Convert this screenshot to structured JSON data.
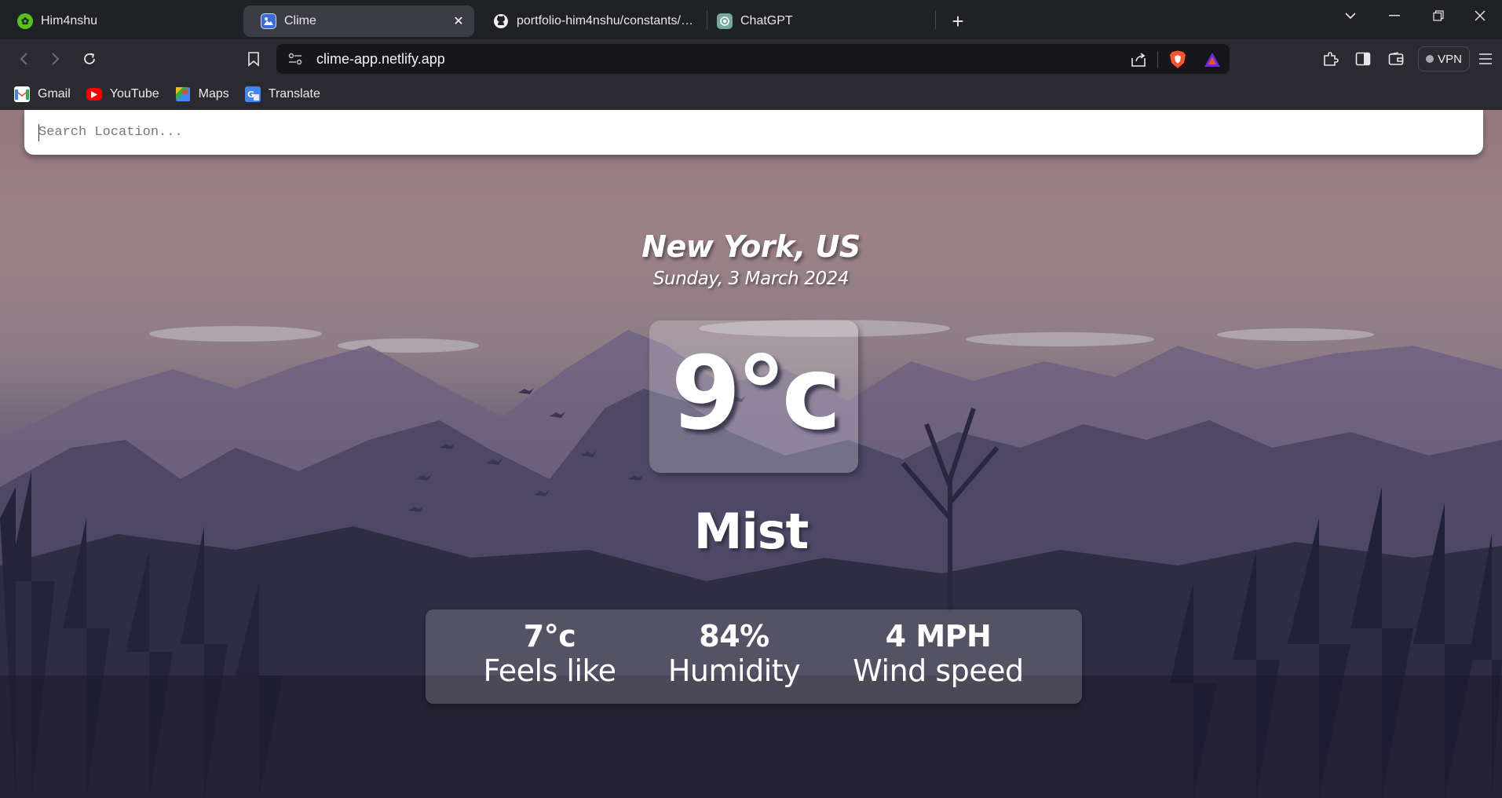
{
  "browser": {
    "tabs": [
      {
        "title": "Him4nshu",
        "active": false
      },
      {
        "title": "Clime",
        "active": true
      },
      {
        "title": "portfolio-him4nshu/constants/index.",
        "active": false
      },
      {
        "title": "ChatGPT",
        "active": false
      }
    ],
    "url": "clime-app.netlify.app",
    "vpn_label": "VPN",
    "bookmarks": [
      "Gmail",
      "YouTube",
      "Maps",
      "Translate"
    ]
  },
  "weather": {
    "search_placeholder": "Search Location...",
    "location": "New York, US",
    "date": "Sunday, 3 March 2024",
    "temperature": "9°c",
    "condition": "Mist",
    "stats": [
      {
        "value": "7°c",
        "label": "Feels like"
      },
      {
        "value": "84%",
        "label": "Humidity"
      },
      {
        "value": "4 MPH",
        "label": "Wind speed"
      }
    ]
  },
  "colors": {
    "tab_strip_bg": "#202124",
    "toolbar_bg": "#2a2a30",
    "omnibox_bg": "#17171b",
    "sky_top": "#96797f",
    "forest_bottom": "#1c1b29"
  },
  "icons": [
    "back-icon",
    "forward-icon",
    "reload-icon",
    "bookmark-icon",
    "site-info-icon",
    "share-icon",
    "brave-shields-icon",
    "brave-rewards-icon",
    "extensions-icon",
    "sidebar-icon",
    "wallet-icon",
    "menu-icon"
  ]
}
